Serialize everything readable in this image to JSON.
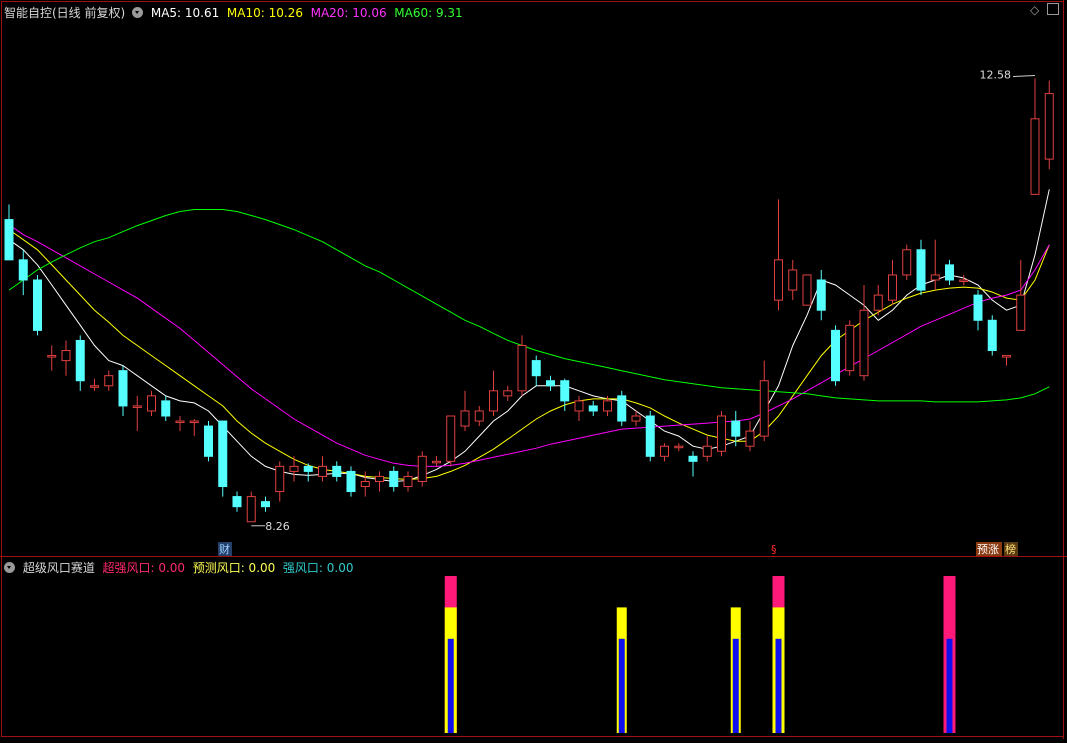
{
  "main": {
    "title": "智能自控(日线 前复权)",
    "ma": [
      {
        "label": "MA5: 10.61",
        "color": "#ffffff"
      },
      {
        "label": "MA10: 10.26",
        "color": "#ffff00"
      },
      {
        "label": "MA20: 10.06",
        "color": "#ff00ff"
      },
      {
        "label": "MA60: 9.31",
        "color": "#00ff00"
      }
    ],
    "corner_icons": [
      "diamond-icon",
      "maximize-icon"
    ]
  },
  "sub": {
    "title": "超级风口赛道",
    "items": [
      {
        "label": "超强风口: 0.00",
        "color": "#ff2a6d"
      },
      {
        "label": "预测风口: 0.00",
        "color": "#ffff55"
      },
      {
        "label": "强风口: 0.00",
        "color": "#33cccc"
      }
    ]
  },
  "colors": {
    "up": "#e04040",
    "down": "#55ffff",
    "bg": "#000000",
    "frame": "#a01010",
    "hi": "#ff1a7a",
    "yellow": "#ffff00",
    "blue": "#1010ee"
  },
  "chart_data": {
    "type": "candlestick",
    "price_range": [
      7.9,
      13.3
    ],
    "annotations": {
      "high": "12.58",
      "low": "8.26",
      "markers": [
        "财",
        "§",
        "预涨",
        "榜"
      ]
    },
    "candles": [
      [
        11.2,
        10.8,
        11.35,
        10.8
      ],
      [
        10.8,
        10.6,
        10.9,
        10.45
      ],
      [
        10.6,
        10.1,
        10.65,
        10.05
      ],
      [
        9.85,
        9.85,
        9.95,
        9.7
      ],
      [
        9.8,
        9.9,
        10.0,
        9.65
      ],
      [
        10.0,
        9.6,
        10.05,
        9.5
      ],
      [
        9.55,
        9.55,
        9.62,
        9.5
      ],
      [
        9.55,
        9.65,
        9.7,
        9.5
      ],
      [
        9.7,
        9.35,
        9.75,
        9.25
      ],
      [
        9.35,
        9.35,
        9.45,
        9.1
      ],
      [
        9.3,
        9.45,
        9.5,
        9.25
      ],
      [
        9.4,
        9.25,
        9.45,
        9.2
      ],
      [
        9.2,
        9.2,
        9.25,
        9.1
      ],
      [
        9.2,
        9.2,
        9.22,
        9.05
      ],
      [
        9.15,
        8.85,
        9.2,
        8.8
      ],
      [
        9.2,
        8.55,
        9.2,
        8.45
      ],
      [
        8.45,
        8.35,
        8.5,
        8.3
      ],
      [
        8.2,
        8.45,
        8.5,
        8.2
      ],
      [
        8.4,
        8.35,
        8.45,
        8.3
      ],
      [
        8.5,
        8.75,
        8.8,
        8.4
      ],
      [
        8.7,
        8.75,
        8.85,
        8.6
      ],
      [
        8.75,
        8.7,
        8.78,
        8.6
      ],
      [
        8.65,
        8.75,
        8.85,
        8.6
      ],
      [
        8.75,
        8.65,
        8.8,
        8.6
      ],
      [
        8.7,
        8.5,
        8.75,
        8.45
      ],
      [
        8.55,
        8.6,
        8.7,
        8.45
      ],
      [
        8.6,
        8.65,
        8.7,
        8.5
      ],
      [
        8.7,
        8.55,
        8.75,
        8.5
      ],
      [
        8.55,
        8.65,
        8.7,
        8.5
      ],
      [
        8.6,
        8.85,
        8.9,
        8.55
      ],
      [
        8.8,
        8.8,
        8.85,
        8.75
      ],
      [
        8.8,
        9.25,
        9.25,
        8.75
      ],
      [
        9.15,
        9.3,
        9.5,
        9.1
      ],
      [
        9.2,
        9.3,
        9.35,
        9.15
      ],
      [
        9.3,
        9.5,
        9.7,
        9.25
      ],
      [
        9.45,
        9.5,
        9.55,
        9.4
      ],
      [
        9.5,
        9.95,
        10.05,
        9.45
      ],
      [
        9.8,
        9.65,
        9.85,
        9.55
      ],
      [
        9.6,
        9.55,
        9.65,
        9.5
      ],
      [
        9.6,
        9.4,
        9.62,
        9.3
      ],
      [
        9.3,
        9.4,
        9.45,
        9.2
      ],
      [
        9.35,
        9.3,
        9.4,
        9.25
      ],
      [
        9.3,
        9.4,
        9.45,
        9.25
      ],
      [
        9.45,
        9.2,
        9.5,
        9.15
      ],
      [
        9.2,
        9.25,
        9.3,
        9.15
      ],
      [
        9.25,
        8.85,
        9.3,
        8.8
      ],
      [
        8.85,
        8.95,
        8.98,
        8.8
      ],
      [
        8.95,
        8.95,
        8.98,
        8.9
      ],
      [
        8.85,
        8.8,
        8.9,
        8.65
      ],
      [
        8.85,
        8.95,
        9.05,
        8.8
      ],
      [
        8.9,
        9.25,
        9.3,
        8.85
      ],
      [
        9.2,
        9.05,
        9.3,
        8.95
      ],
      [
        8.95,
        9.1,
        9.2,
        8.9
      ],
      [
        9.05,
        9.6,
        9.8,
        9.0
      ],
      [
        10.4,
        10.8,
        11.4,
        10.3
      ],
      [
        10.5,
        10.7,
        10.8,
        10.4
      ],
      [
        10.35,
        10.65,
        10.6,
        10.35
      ],
      [
        10.6,
        10.3,
        10.7,
        10.2
      ],
      [
        10.1,
        9.6,
        10.15,
        9.55
      ],
      [
        9.7,
        10.15,
        10.2,
        9.65
      ],
      [
        9.65,
        10.3,
        10.55,
        9.6
      ],
      [
        10.3,
        10.45,
        10.55,
        10.25
      ],
      [
        10.4,
        10.65,
        10.8,
        10.35
      ],
      [
        10.65,
        10.9,
        10.95,
        10.6
      ],
      [
        10.9,
        10.5,
        11.0,
        10.45
      ],
      [
        10.6,
        10.65,
        11.0,
        10.5
      ],
      [
        10.75,
        10.6,
        10.8,
        10.55
      ],
      [
        10.6,
        10.6,
        10.65,
        10.55
      ],
      [
        10.45,
        10.2,
        10.5,
        10.1
      ],
      [
        10.2,
        9.9,
        10.25,
        9.85
      ],
      [
        9.85,
        9.85,
        9.85,
        9.75
      ],
      [
        10.1,
        10.45,
        10.8,
        10.1
      ],
      [
        11.45,
        12.2,
        12.6,
        11.45
      ],
      [
        11.8,
        12.45,
        12.58,
        11.7
      ]
    ],
    "ma_lines": {
      "MA5": {
        "color": "#ffffff",
        "values": [
          11.0,
          10.9,
          10.75,
          10.55,
          10.35,
          10.15,
          9.95,
          9.8,
          9.75,
          9.65,
          9.55,
          9.45,
          9.4,
          9.38,
          9.3,
          9.15,
          9.0,
          8.85,
          8.75,
          8.7,
          8.67,
          8.66,
          8.67,
          8.68,
          8.68,
          8.64,
          8.62,
          8.6,
          8.61,
          8.66,
          8.72,
          8.8,
          8.9,
          9.05,
          9.2,
          9.3,
          9.45,
          9.55,
          9.55,
          9.55,
          9.5,
          9.45,
          9.42,
          9.4,
          9.3,
          9.2,
          9.1,
          9.05,
          8.95,
          8.92,
          8.95,
          9.0,
          9.05,
          9.3,
          9.55,
          9.95,
          10.25,
          10.6,
          10.55,
          10.45,
          10.35,
          10.2,
          10.3,
          10.45,
          10.55,
          10.6,
          10.65,
          10.62,
          10.55,
          10.4,
          10.3,
          10.35,
          10.85,
          11.5
        ]
      },
      "MA10": {
        "color": "#ffff00",
        "values": [
          11.1,
          11.0,
          10.9,
          10.75,
          10.6,
          10.45,
          10.3,
          10.18,
          10.05,
          9.95,
          9.85,
          9.75,
          9.65,
          9.55,
          9.45,
          9.35,
          9.2,
          9.08,
          8.98,
          8.9,
          8.82,
          8.76,
          8.72,
          8.7,
          8.68,
          8.65,
          8.64,
          8.63,
          8.62,
          8.63,
          8.65,
          8.7,
          8.76,
          8.84,
          8.92,
          9.02,
          9.12,
          9.22,
          9.3,
          9.36,
          9.4,
          9.42,
          9.42,
          9.42,
          9.38,
          9.33,
          9.25,
          9.18,
          9.12,
          9.06,
          9.03,
          9.0,
          9.0,
          9.1,
          9.25,
          9.45,
          9.65,
          9.85,
          10.0,
          10.1,
          10.2,
          10.28,
          10.36,
          10.42,
          10.47,
          10.5,
          10.52,
          10.53,
          10.52,
          10.48,
          10.42,
          10.4,
          10.6,
          10.95
        ]
      },
      "MA20": {
        "color": "#ff00ff",
        "values": [
          11.15,
          11.05,
          10.98,
          10.9,
          10.82,
          10.74,
          10.66,
          10.58,
          10.5,
          10.42,
          10.32,
          10.22,
          10.12,
          10.0,
          9.88,
          9.76,
          9.64,
          9.52,
          9.42,
          9.32,
          9.22,
          9.14,
          9.06,
          8.98,
          8.92,
          8.86,
          8.82,
          8.78,
          8.76,
          8.75,
          8.75,
          8.76,
          8.78,
          8.81,
          8.84,
          8.87,
          8.9,
          8.93,
          8.97,
          9.0,
          9.03,
          9.06,
          9.09,
          9.12,
          9.13,
          9.14,
          9.15,
          9.16,
          9.17,
          9.18,
          9.19,
          9.2,
          9.22,
          9.28,
          9.35,
          9.42,
          9.5,
          9.58,
          9.66,
          9.74,
          9.82,
          9.9,
          9.98,
          10.06,
          10.14,
          10.2,
          10.26,
          10.32,
          10.38,
          10.42,
          10.45,
          10.5,
          10.7,
          10.95
        ]
      },
      "MA60": {
        "color": "#00ff00",
        "values": [
          10.5,
          10.6,
          10.7,
          10.78,
          10.85,
          10.92,
          10.98,
          11.02,
          11.08,
          11.14,
          11.19,
          11.24,
          11.28,
          11.3,
          11.3,
          11.3,
          11.28,
          11.24,
          11.2,
          11.15,
          11.1,
          11.04,
          10.98,
          10.9,
          10.82,
          10.74,
          10.68,
          10.6,
          10.52,
          10.44,
          10.36,
          10.28,
          10.2,
          10.14,
          10.07,
          10.0,
          9.95,
          9.9,
          9.86,
          9.82,
          9.79,
          9.76,
          9.73,
          9.7,
          9.67,
          9.64,
          9.61,
          9.59,
          9.57,
          9.55,
          9.53,
          9.52,
          9.51,
          9.5,
          9.49,
          9.48,
          9.47,
          9.45,
          9.43,
          9.42,
          9.41,
          9.4,
          9.4,
          9.4,
          9.4,
          9.39,
          9.39,
          9.39,
          9.39,
          9.4,
          9.41,
          9.43,
          9.47,
          9.54
        ]
      }
    },
    "signals": [
      {
        "bar": 31,
        "values": [
          100,
          80,
          60
        ]
      },
      {
        "bar": 43,
        "values": null,
        "yellow_only": [
          80,
          60
        ]
      },
      {
        "bar": 51,
        "values": null,
        "yellow_only": [
          80,
          60
        ]
      },
      {
        "bar": 54,
        "values": [
          100,
          80,
          60
        ]
      },
      {
        "bar": 66,
        "values": [
          100,
          null,
          60
        ]
      }
    ]
  }
}
